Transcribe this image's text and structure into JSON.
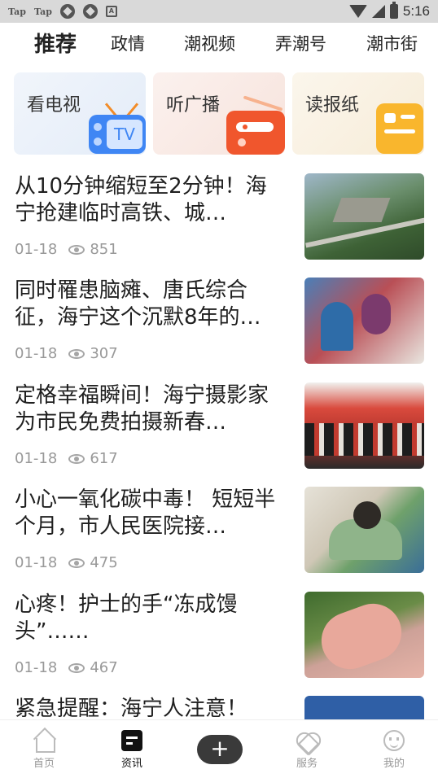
{
  "status_bar": {
    "left_labels": [
      "Tap",
      "Tap"
    ],
    "app_icon_letter": "A",
    "time": "5:16"
  },
  "tabs": [
    "推荐",
    "政情",
    "潮视频",
    "弄潮号",
    "潮市街"
  ],
  "media_cards": [
    {
      "label": "看电视",
      "icon": "tv-icon",
      "icon_text": "TV"
    },
    {
      "label": "听广播",
      "icon": "radio-icon"
    },
    {
      "label": "读报纸",
      "icon": "newspaper-icon"
    }
  ],
  "news": [
    {
      "title": "从10分钟缩短至2分钟！海宁抢建临时高铁、城…",
      "date": "01-18",
      "views": "851"
    },
    {
      "title": "同时罹患脑瘫、唐氏综合征，海宁这个沉默8年的…",
      "date": "01-18",
      "views": "307"
    },
    {
      "title": "定格幸福瞬间！海宁摄影家为市民免费拍摄新春…",
      "date": "01-18",
      "views": "617"
    },
    {
      "title": "小心一氧化碳中毒！ 短短半个月，市人民医院接…",
      "date": "01-18",
      "views": "475"
    },
    {
      "title": "心疼！护士的手“冻成馒头”……",
      "date": "01-18",
      "views": "467"
    },
    {
      "title": "紧急提醒：海宁人注意！",
      "date": "",
      "views": ""
    }
  ],
  "bottom_nav": [
    {
      "label": "首页",
      "icon": "home-icon"
    },
    {
      "label": "资讯",
      "icon": "news-icon"
    },
    {
      "label": "+",
      "icon": "plus-icon"
    },
    {
      "label": "服务",
      "icon": "heart-icon"
    },
    {
      "label": "我的",
      "icon": "face-icon"
    }
  ]
}
